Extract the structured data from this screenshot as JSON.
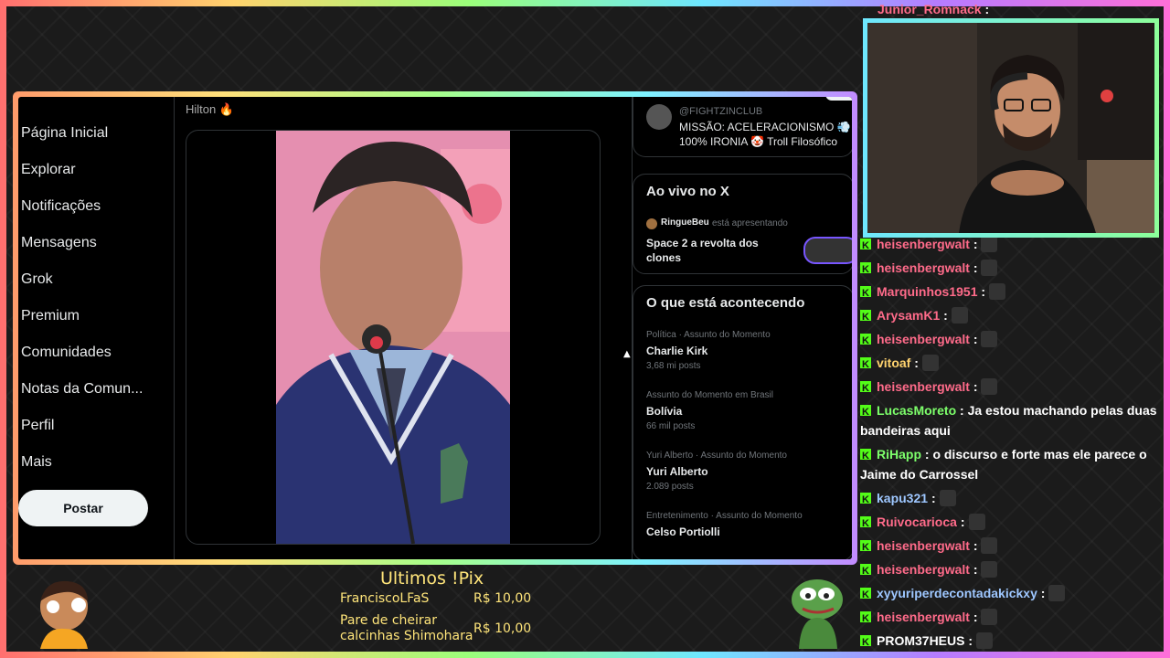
{
  "stream": {
    "pix_title": "Ultimos !Pix",
    "pix": [
      {
        "name": "FranciscoLFaS",
        "value": "R$ 10,00"
      },
      {
        "name": "Pare de cheirar calcinhas Shimohara",
        "name_line1": "Pare de cheirar",
        "name_line2": "calcinhas Shimohara",
        "value": "R$ 10,00"
      }
    ]
  },
  "nav": {
    "items": [
      "Página Inicial",
      "Explorar",
      "Notificações",
      "Mensagens",
      "Grok",
      "Premium",
      "Comunidades",
      "Notas da Comun...",
      "Perfil",
      "Mais"
    ],
    "post_label": "Postar"
  },
  "feed": {
    "top_text": "Hilton 🔥"
  },
  "sidebar": {
    "account_handle": "@FIGHTZINCLUB",
    "account_line1": "MISSÃO: ACELERACIONISMO 💨",
    "account_line2": "100% IRONIA 🤡 Troll Filosófico",
    "live_title": "Ao vivo no X",
    "live_host": "RingueBeu",
    "live_host_suffix": "está apresentando",
    "live_space_title": "Space 2 a revolta dos clones",
    "live_space_line1": "Space 2 a revolta dos",
    "live_space_line2": "clones",
    "trends_title": "O que está acontecendo",
    "trends": [
      {
        "meta": "Política · Assunto do Momento",
        "topic": "Charlie Kirk",
        "posts": "3,68 mi posts"
      },
      {
        "meta": "Assunto do Momento em Brasil",
        "topic": "Bolívia",
        "posts": "66 mil posts"
      },
      {
        "meta": "Yuri Alberto · Assunto do Momento",
        "topic": "Yuri Alberto",
        "posts": "2.089 posts"
      },
      {
        "meta": "Entretenimento · Assunto do Momento",
        "topic": "Celso Portiolli",
        "posts": ""
      }
    ]
  },
  "chat": {
    "messages": [
      {
        "user": "Junior_Romnack",
        "text": ":",
        "color": "pink"
      },
      {
        "user": "heisenbergwalt",
        "text": ":",
        "color": "pink"
      },
      {
        "user": "heisenbergwalt",
        "text": ":",
        "color": "pink"
      },
      {
        "user": "Marquinhos1951",
        "text": ":",
        "color": "pink"
      },
      {
        "user": "ArysamK1",
        "text": ":",
        "color": "pink"
      },
      {
        "user": "heisenbergwalt",
        "text": ":",
        "color": "pink"
      },
      {
        "user": "vitoaf",
        "text": ":",
        "color": "yellow"
      },
      {
        "user": "heisenbergwalt",
        "text": ":",
        "color": "pink"
      },
      {
        "user": "LucasMoreto",
        "text": ": Ja estou machando pelas duas bandeiras aqui",
        "line1": ": Ja estou machando pelas duas",
        "line2": "bandeiras aqui",
        "color": "green"
      },
      {
        "user": "RiHapp",
        "text": ": o discurso e forte mas ele parece o Jaime do Carrossel",
        "line1": ": o discurso e forte mas ele parece o",
        "line2": "Jaime do Carrossel",
        "color": "green"
      },
      {
        "user": "kapu321",
        "text": ":",
        "color": "blue"
      },
      {
        "user": "Ruivocarioca",
        "text": ":",
        "color": "pink"
      },
      {
        "user": "heisenbergwalt",
        "text": ":",
        "color": "pink"
      },
      {
        "user": "heisenbergwalt",
        "text": ":",
        "color": "pink"
      },
      {
        "user": "xyyuriperdecontadakickxy",
        "text": ":",
        "color": "blue"
      },
      {
        "user": "heisenbergwalt",
        "text": ":",
        "color": "pink"
      },
      {
        "user": "PROM37HEUS",
        "text": ":",
        "color": "white"
      }
    ]
  }
}
